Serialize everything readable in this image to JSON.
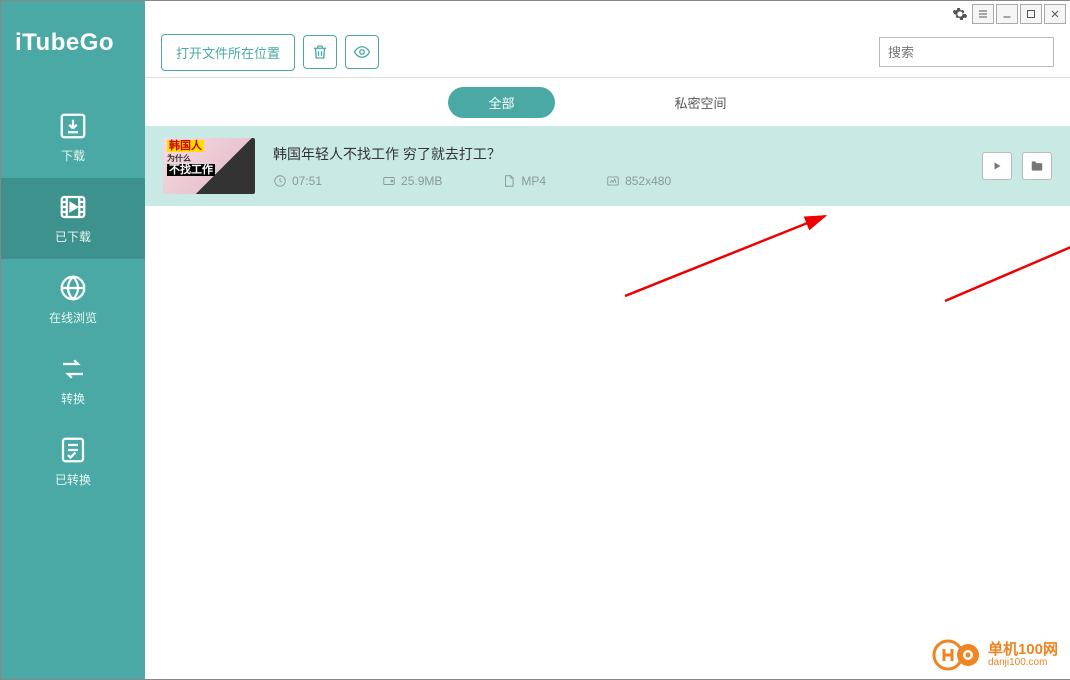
{
  "app": {
    "name": "iTubeGo"
  },
  "sidebar": {
    "items": [
      {
        "label": "下载"
      },
      {
        "label": "已下载"
      },
      {
        "label": "在线浏览"
      },
      {
        "label": "转换"
      },
      {
        "label": "已转换"
      }
    ]
  },
  "toolbar": {
    "open_location": "打开文件所在位置"
  },
  "search": {
    "placeholder": "搜索"
  },
  "tabs": {
    "all": "全部",
    "private": "私密空间"
  },
  "item": {
    "title": "韩国年轻人不找工作 穷了就去打工？",
    "duration": "07:51",
    "size": "25.9MB",
    "format": "MP4",
    "resolution": "852x480",
    "thumb_text1": "韩国人",
    "thumb_text2": "为什么",
    "thumb_text3": "不找工作"
  },
  "watermark": {
    "title": "单机100网",
    "url": "danji100.com"
  }
}
